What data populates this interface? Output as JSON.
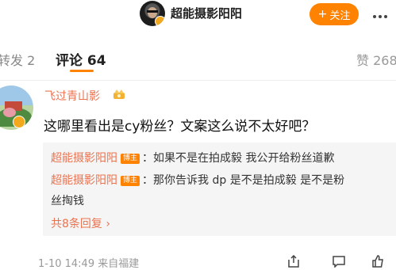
{
  "header": {
    "title": "超能摄影阳阳",
    "follow_label": "关注",
    "follow_icon": "+"
  },
  "tabs": {
    "repost_label": "转发 2",
    "comment_label": "评论 64",
    "like_label": "赞 268"
  },
  "comment": {
    "author": "飞过青山影",
    "text": "这哪里看出是cy粉丝？文案这么说不太好吧？",
    "timestamp": "1-10 14:49  来自福建"
  },
  "replies": [
    {
      "author": "超能摄影阳阳",
      "tag": "博主",
      "text": "：如果不是在拍成毅 我公开给粉丝道歉"
    },
    {
      "author": "超能摄影阳阳",
      "tag": "博主",
      "text": "：那你告诉我 dp 是不是拍成毅 是不是粉",
      "text_cont": "丝掏钱"
    }
  ],
  "more_replies_label": "共8条回复 ›",
  "colors": {
    "accent": "#ff8200",
    "username": "#eb7350",
    "muted": "#999999"
  },
  "icons": [
    "more-icon",
    "crown-icon",
    "share-icon",
    "comment-icon",
    "like-icon",
    "verified-badge-icon"
  ]
}
